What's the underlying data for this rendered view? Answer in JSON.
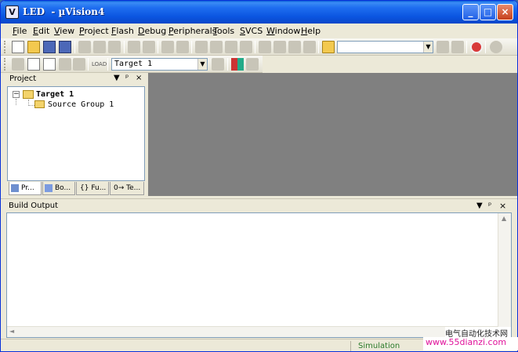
{
  "window": {
    "title": "LED  - µVision4",
    "app_icon_glyph": "V",
    "controls": {
      "minimize": "_",
      "maximize": "□",
      "close": "×"
    }
  },
  "menu": [
    {
      "label": "File",
      "key": "F",
      "rest": "ile"
    },
    {
      "label": "Edit",
      "key": "E",
      "rest": "dit"
    },
    {
      "label": "View",
      "key": "V",
      "rest": "iew"
    },
    {
      "label": "Project",
      "key": "P",
      "rest": "roject"
    },
    {
      "label": "Flash",
      "key": "F",
      "rest": "lash"
    },
    {
      "label": "Debug",
      "key": "D",
      "rest": "ebug"
    },
    {
      "label": "Peripherals",
      "key": "P",
      "rest": "eripherals"
    },
    {
      "label": "Tools",
      "key": "T",
      "rest": "ools"
    },
    {
      "label": "SVCS",
      "key": "S",
      "rest": "VCS"
    },
    {
      "label": "Window",
      "key": "W",
      "rest": "indow"
    },
    {
      "label": "Help",
      "key": "H",
      "rest": "elp"
    }
  ],
  "toolbar2": {
    "load_label": "LOAD",
    "target_select": "Target 1",
    "target_select_arrow": "▼"
  },
  "toolbar1": {
    "find_combo_value": "",
    "find_combo_arrow": "▼"
  },
  "project_panel": {
    "title": "Project",
    "ctrl_dropdown": "▼",
    "ctrl_pin": "ᵖ",
    "ctrl_close": "×",
    "tree": {
      "expander": "−",
      "target": "Target 1",
      "group": "Source Group 1"
    },
    "tabs": [
      "Pr...",
      "Bo...",
      "{} Fu...",
      "0→ Te..."
    ]
  },
  "build_output": {
    "title": "Build Output",
    "ctrl_dropdown": "▼",
    "ctrl_pin": "ᵖ",
    "ctrl_close": "×",
    "scroll_up": "▲",
    "scroll_left": "◄"
  },
  "status": {
    "mode": "Simulation"
  },
  "watermark": {
    "line1": "电气自动化技术网",
    "line2": "www.55dianzi.com"
  }
}
